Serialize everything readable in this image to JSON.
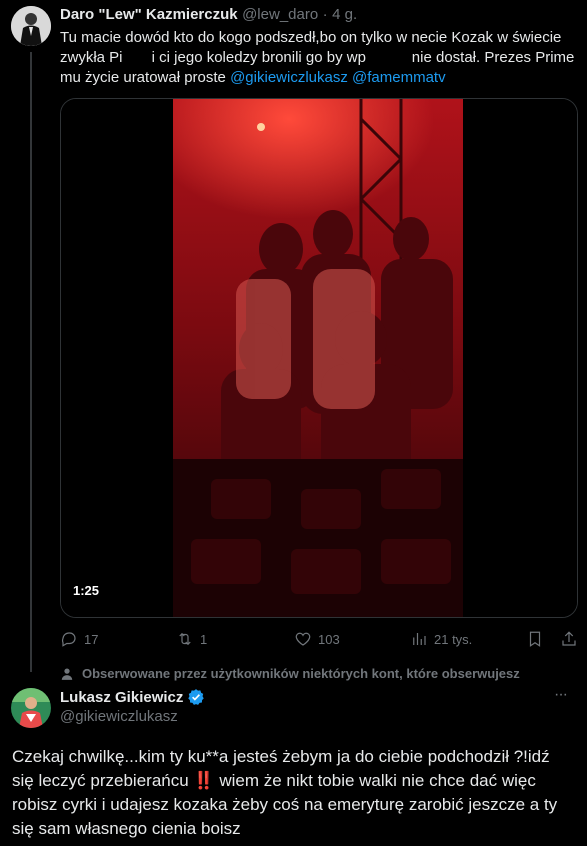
{
  "tweet1": {
    "author_name": "Daro \"Lew\" Kazmierczuk",
    "handle": "@lew_daro",
    "dot": "·",
    "time": "4 g.",
    "text_line1": "Tu macie dowód kto do kogo podszedł,bo on tylko w necie Kozak w świecie",
    "text_line2": "zwykła Pi       i ci jego koledzy bronili go by wp           nie dostał. Prezes Prime",
    "text_line3_prefix": "mu życie uratował proste ",
    "mention1": "@gikiewiczlukasz",
    "mention2": "@famemmatv",
    "video_duration": "1:25",
    "stats": {
      "replies": "17",
      "reposts": "1",
      "likes": "103",
      "views": "21 tys."
    }
  },
  "social_context": {
    "icon": "person-icon",
    "text": "Obserwowane przez użytkowników niektórych kont, które obserwujesz"
  },
  "tweet2": {
    "author_name": "Lukasz Gikiewicz",
    "verified_color": "#1d9bf0",
    "handle": "@gikiewiczlukasz",
    "more": "···",
    "text_line1": "Czekaj chwilkę...kim ty ku**a jesteś żebym ja do ciebie podchodził ?!idź",
    "text_line2": "się leczyć przebierańcu ",
    "emoji": "‼️",
    "text_line2_rest": " wiem że nikt tobie walki nie chce dać więc",
    "text_line3": "robisz cyrki i udajesz kozaka żeby coś na emeryturę zarobić jeszcze a ty",
    "text_line4": "się sam własnego cienia boisz"
  },
  "colors": {
    "accent": "#1d9bf0",
    "muted": "#71767b",
    "background": "#000000",
    "text": "#e7e9ea"
  }
}
